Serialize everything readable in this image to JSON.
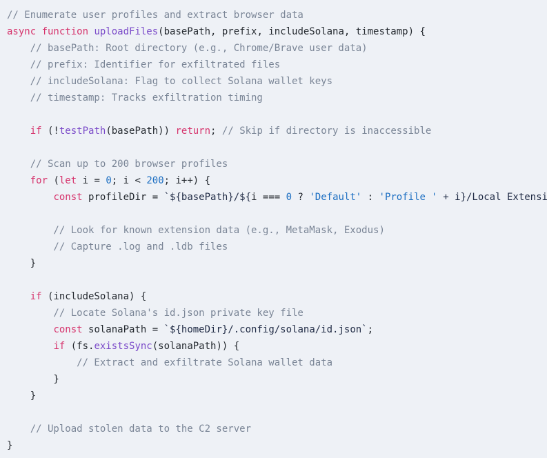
{
  "editor": {
    "language": "javascript",
    "background_color": "#eef1f6",
    "colors": {
      "comment": "#7a8596",
      "keyword": "#d6336c",
      "function": "#7b4bc9",
      "plain": "#24292f",
      "number": "#1b6ec2",
      "string": "#1b6ec2",
      "template": "#1f2a44"
    },
    "lines": [
      {
        "id": "line-1",
        "tokens": [
          {
            "t": "// Enumerate user profiles and extract browser data",
            "c": "comment"
          }
        ]
      },
      {
        "id": "line-2",
        "tokens": [
          {
            "t": "async function ",
            "c": "keyword"
          },
          {
            "t": "uploadFiles",
            "c": "function"
          },
          {
            "t": "(basePath, prefix, includeSolana, timestamp) {",
            "c": "plain"
          }
        ]
      },
      {
        "id": "line-3",
        "tokens": [
          {
            "t": "    // basePath: Root directory (e.g., Chrome/Brave user data)",
            "c": "comment"
          }
        ]
      },
      {
        "id": "line-4",
        "tokens": [
          {
            "t": "    // prefix: Identifier for exfiltrated files",
            "c": "comment"
          }
        ]
      },
      {
        "id": "line-5",
        "tokens": [
          {
            "t": "    // includeSolana: Flag to collect Solana wallet keys",
            "c": "comment"
          }
        ]
      },
      {
        "id": "line-6",
        "tokens": [
          {
            "t": "    // timestamp: Tracks exfiltration timing",
            "c": "comment"
          }
        ]
      },
      {
        "id": "line-7",
        "tokens": [
          {
            "t": "",
            "c": "plain"
          }
        ]
      },
      {
        "id": "line-8",
        "tokens": [
          {
            "t": "    ",
            "c": "plain"
          },
          {
            "t": "if",
            "c": "keyword"
          },
          {
            "t": " (!",
            "c": "plain"
          },
          {
            "t": "testPath",
            "c": "function"
          },
          {
            "t": "(basePath)) ",
            "c": "plain"
          },
          {
            "t": "return",
            "c": "keyword"
          },
          {
            "t": "; ",
            "c": "plain"
          },
          {
            "t": "// Skip if directory is inaccessible",
            "c": "comment"
          }
        ]
      },
      {
        "id": "line-9",
        "tokens": [
          {
            "t": "",
            "c": "plain"
          }
        ]
      },
      {
        "id": "line-10",
        "tokens": [
          {
            "t": "    // Scan up to 200 browser profiles",
            "c": "comment"
          }
        ]
      },
      {
        "id": "line-11",
        "tokens": [
          {
            "t": "    ",
            "c": "plain"
          },
          {
            "t": "for",
            "c": "keyword"
          },
          {
            "t": " (",
            "c": "plain"
          },
          {
            "t": "let",
            "c": "keyword"
          },
          {
            "t": " i = ",
            "c": "plain"
          },
          {
            "t": "0",
            "c": "number"
          },
          {
            "t": "; i < ",
            "c": "plain"
          },
          {
            "t": "200",
            "c": "number"
          },
          {
            "t": "; i++) {",
            "c": "plain"
          }
        ]
      },
      {
        "id": "line-12",
        "tokens": [
          {
            "t": "        ",
            "c": "plain"
          },
          {
            "t": "const",
            "c": "keyword"
          },
          {
            "t": " profileDir = ",
            "c": "plain"
          },
          {
            "t": "`${basePath}/${",
            "c": "template"
          },
          {
            "t": "i === ",
            "c": "plain"
          },
          {
            "t": "0",
            "c": "number"
          },
          {
            "t": " ? ",
            "c": "plain"
          },
          {
            "t": "'Default'",
            "c": "string"
          },
          {
            "t": " : ",
            "c": "plain"
          },
          {
            "t": "'Profile '",
            "c": "string"
          },
          {
            "t": " + i}/Local Extension Settings`;",
            "c": "template"
          }
        ]
      },
      {
        "id": "line-13",
        "tokens": [
          {
            "t": "",
            "c": "plain"
          }
        ]
      },
      {
        "id": "line-14",
        "tokens": [
          {
            "t": "        // Look for known extension data (e.g., MetaMask, Exodus)",
            "c": "comment"
          }
        ]
      },
      {
        "id": "line-15",
        "tokens": [
          {
            "t": "        // Capture .log and .ldb files",
            "c": "comment"
          }
        ]
      },
      {
        "id": "line-16",
        "tokens": [
          {
            "t": "    }",
            "c": "plain"
          }
        ]
      },
      {
        "id": "line-17",
        "tokens": [
          {
            "t": "",
            "c": "plain"
          }
        ]
      },
      {
        "id": "line-18",
        "tokens": [
          {
            "t": "    ",
            "c": "plain"
          },
          {
            "t": "if",
            "c": "keyword"
          },
          {
            "t": " (includeSolana) {",
            "c": "plain"
          }
        ]
      },
      {
        "id": "line-19",
        "tokens": [
          {
            "t": "        // Locate Solana's id.json private key file",
            "c": "comment"
          }
        ]
      },
      {
        "id": "line-20",
        "tokens": [
          {
            "t": "        ",
            "c": "plain"
          },
          {
            "t": "const",
            "c": "keyword"
          },
          {
            "t": " solanaPath = ",
            "c": "plain"
          },
          {
            "t": "`${homeDir}/.config/solana/id.json`",
            "c": "template"
          },
          {
            "t": ";",
            "c": "plain"
          }
        ]
      },
      {
        "id": "line-21",
        "tokens": [
          {
            "t": "        ",
            "c": "plain"
          },
          {
            "t": "if",
            "c": "keyword"
          },
          {
            "t": " (fs.",
            "c": "plain"
          },
          {
            "t": "existsSync",
            "c": "function"
          },
          {
            "t": "(solanaPath)) {",
            "c": "plain"
          }
        ]
      },
      {
        "id": "line-22",
        "tokens": [
          {
            "t": "            // Extract and exfiltrate Solana wallet data",
            "c": "comment"
          }
        ]
      },
      {
        "id": "line-23",
        "tokens": [
          {
            "t": "        }",
            "c": "plain"
          }
        ]
      },
      {
        "id": "line-24",
        "tokens": [
          {
            "t": "    }",
            "c": "plain"
          }
        ]
      },
      {
        "id": "line-25",
        "tokens": [
          {
            "t": "",
            "c": "plain"
          }
        ]
      },
      {
        "id": "line-26",
        "tokens": [
          {
            "t": "    // Upload stolen data to the C2 server",
            "c": "comment"
          }
        ]
      },
      {
        "id": "line-27",
        "tokens": [
          {
            "t": "}",
            "c": "plain"
          }
        ]
      }
    ]
  }
}
